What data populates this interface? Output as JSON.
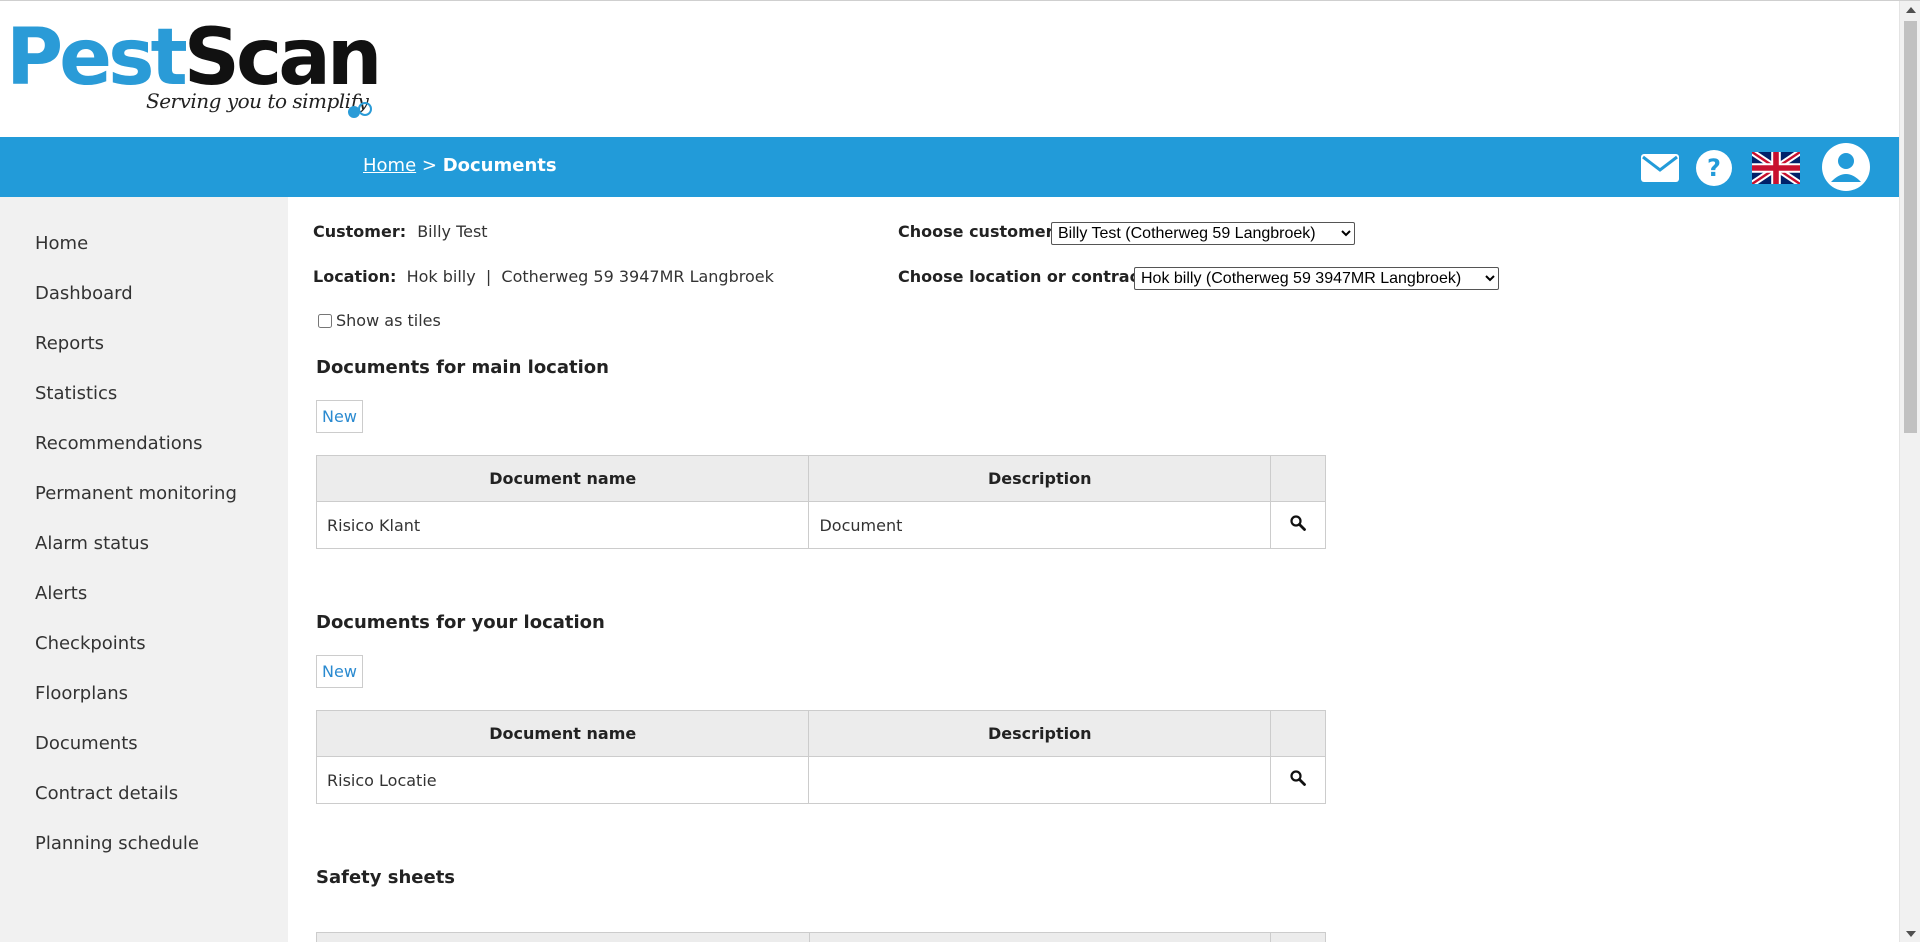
{
  "logo": {
    "brand_part1": "Pest",
    "brand_part2": "Scan",
    "tagline": "Serving you to simplify",
    "colors": {
      "pest": "#2a9bd7",
      "scan": "#111111"
    }
  },
  "navbar": {
    "color": "#229bd9",
    "breadcrumb_home": "Home",
    "breadcrumb_separator": " > ",
    "breadcrumb_current": "Documents",
    "icons": [
      "mail-icon",
      "help-icon",
      "uk-flag-icon",
      "user-profile-icon"
    ]
  },
  "sidebar": {
    "items": [
      {
        "label": "Home"
      },
      {
        "label": "Dashboard"
      },
      {
        "label": "Reports"
      },
      {
        "label": "Statistics"
      },
      {
        "label": "Recommendations"
      },
      {
        "label": "Permanent monitoring"
      },
      {
        "label": "Alarm status"
      },
      {
        "label": "Alerts"
      },
      {
        "label": "Checkpoints"
      },
      {
        "label": "Floorplans"
      },
      {
        "label": "Documents"
      },
      {
        "label": "Contract details"
      },
      {
        "label": "Planning schedule"
      }
    ]
  },
  "info": {
    "customer_label": "Customer:",
    "customer_value": "Billy Test",
    "location_label": "Location:",
    "location_value": "Hok billy  |  Cotherweg 59 3947MR Langbroek",
    "choose_customer_label": "Choose customer",
    "choose_customer_selected": "Billy Test (Cotherweg 59 Langbroek)",
    "choose_location_label": "Choose location or contract",
    "choose_location_selected": "Hok billy (Cotherweg 59 3947MR Langbroek)",
    "show_as_tiles_label": "Show as tiles",
    "show_as_tiles_checked": false
  },
  "sections": {
    "main_location": {
      "title": "Documents for main location",
      "new_label": "New",
      "columns": [
        "Document name",
        "Description",
        ""
      ],
      "rows": [
        {
          "name": "Risico Klant",
          "description": "Document"
        }
      ]
    },
    "your_location": {
      "title": "Documents for your location",
      "new_label": "New",
      "columns": [
        "Document name",
        "Description",
        ""
      ],
      "rows": [
        {
          "name": "Risico Locatie",
          "description": ""
        }
      ]
    },
    "safety_sheets": {
      "title": "Safety sheets"
    }
  }
}
